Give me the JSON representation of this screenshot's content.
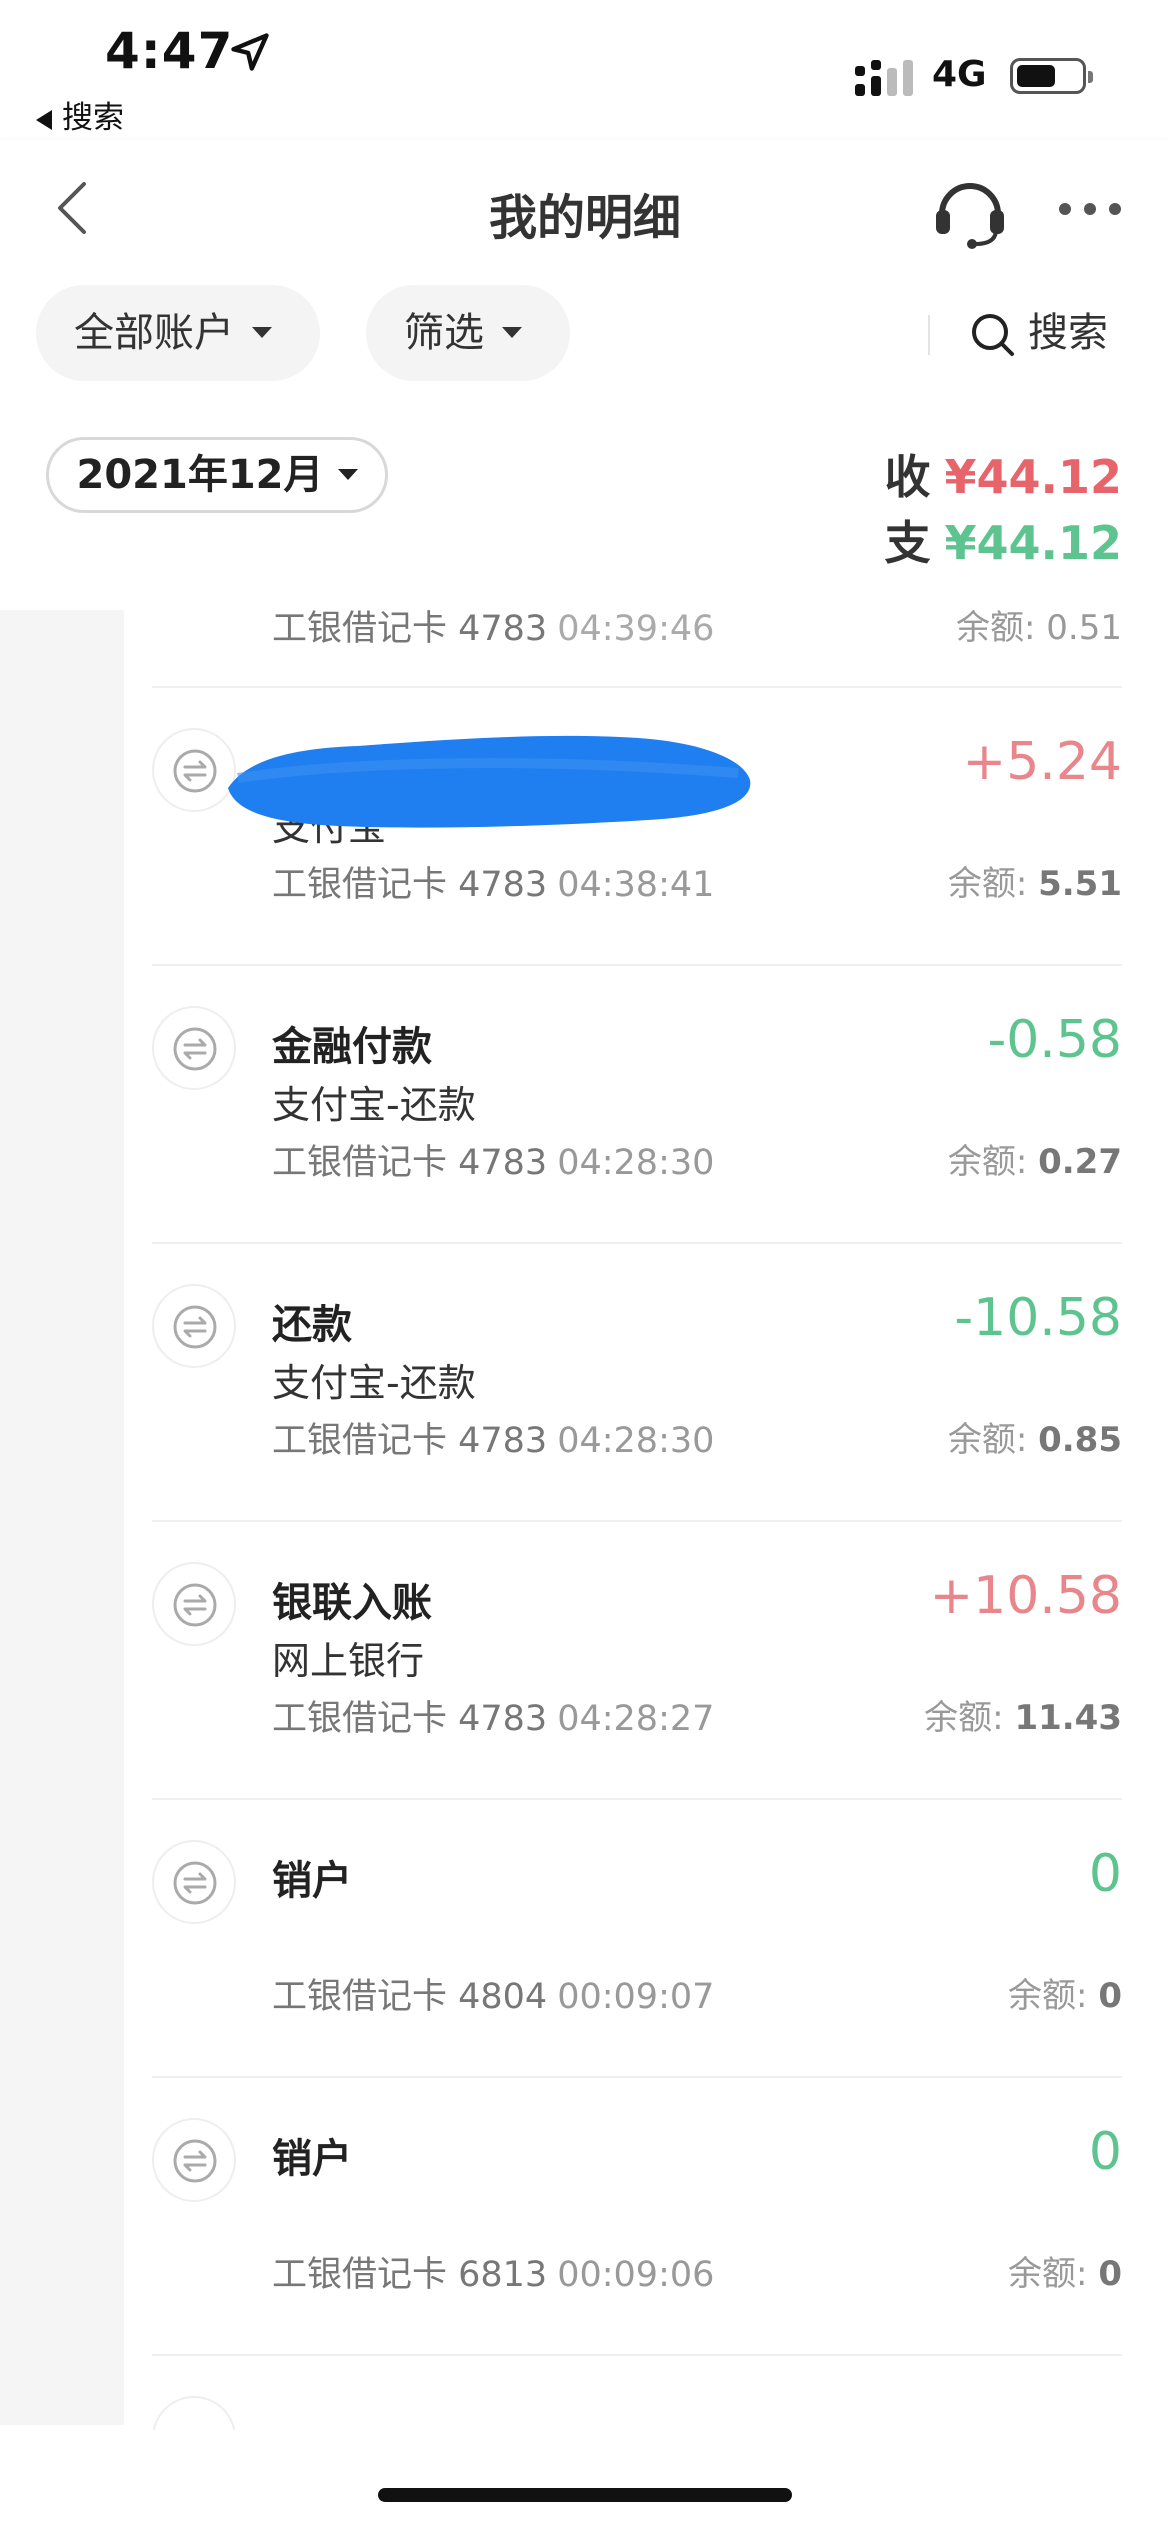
{
  "status": {
    "time": "4:47",
    "back_label": "搜索",
    "network": "4G"
  },
  "nav": {
    "title": "我的明细"
  },
  "filters": {
    "accounts_label": "全部账户",
    "filter_label": "筛选",
    "search_label": "搜索"
  },
  "summary": {
    "month": "2021年12月",
    "income_label": "收",
    "income_value": "¥44.12",
    "expense_label": "支",
    "expense_value": "¥44.12"
  },
  "partial_row": {
    "card": "工银借记卡 4783",
    "time": "04:39:46",
    "balance_label": "余额:",
    "balance": "0.51"
  },
  "transactions": [
    {
      "title": "",
      "sub": "支付宝",
      "card": "工银借记卡 4783",
      "time": "04:38:41",
      "amount": "+5.24",
      "sign": "pos",
      "balance_label": "余额:",
      "balance": "5.51"
    },
    {
      "title": "金融付款",
      "sub": "支付宝-还款",
      "card": "工银借记卡 4783",
      "time": "04:28:30",
      "amount": "-0.58",
      "sign": "neg",
      "balance_label": "余额:",
      "balance": "0.27"
    },
    {
      "title": "还款",
      "sub": "支付宝-还款",
      "card": "工银借记卡 4783",
      "time": "04:28:30",
      "amount": "-10.58",
      "sign": "neg",
      "balance_label": "余额:",
      "balance": "0.85"
    },
    {
      "title": "银联入账",
      "sub": "网上银行",
      "card": "工银借记卡 4783",
      "time": "04:28:27",
      "amount": "+10.58",
      "sign": "pos",
      "balance_label": "余额:",
      "balance": "11.43"
    },
    {
      "title": "销户",
      "sub": "",
      "card": "工银借记卡 4804",
      "time": "00:09:07",
      "amount": "0",
      "sign": "neg",
      "balance_label": "余额:",
      "balance": "0"
    },
    {
      "title": "销户",
      "sub": "",
      "card": "工银借记卡 6813",
      "time": "00:09:06",
      "amount": "0",
      "sign": "neg",
      "balance_label": "余额:",
      "balance": "0"
    }
  ],
  "colors": {
    "income": "#e8646b",
    "expense": "#5ec48f",
    "redaction": "#1f7ff0"
  }
}
